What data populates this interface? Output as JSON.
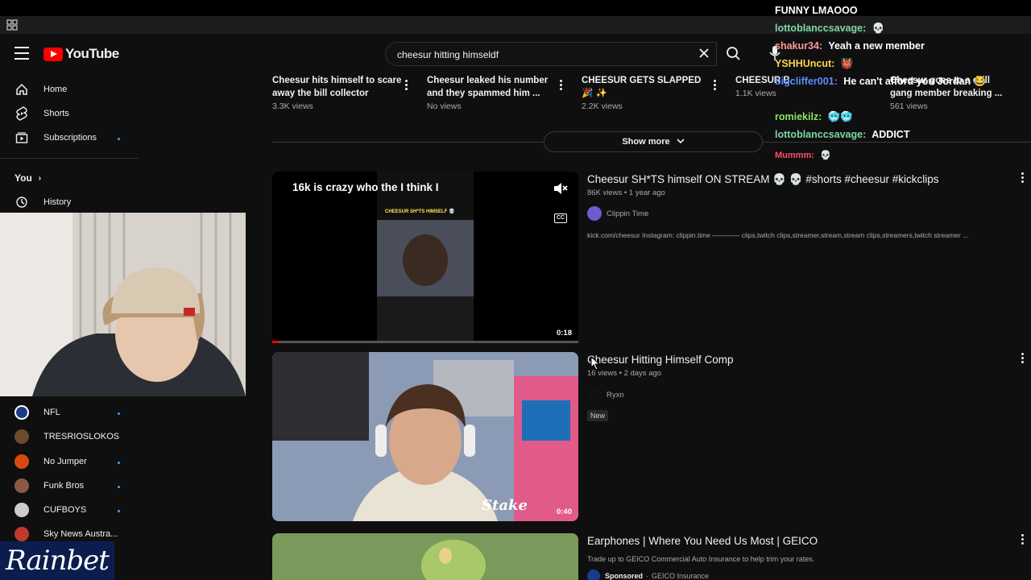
{
  "header": {
    "logo_text": "YouTube",
    "search_value": "cheesur hitting himseldf"
  },
  "sidebar": {
    "items": [
      {
        "label": "Home"
      },
      {
        "label": "Shorts"
      },
      {
        "label": "Subscriptions"
      }
    ],
    "you_label": "You",
    "history_label": "History",
    "channels": [
      {
        "label": "NFL",
        "color": "#1e3a8a"
      },
      {
        "label": "TRESRIOSLOKOS",
        "color": "#6b4b2a"
      },
      {
        "label": "No Jumper",
        "color": "#d9480f"
      },
      {
        "label": "Funk Bros",
        "color": "#8a5a44"
      },
      {
        "label": "CUFBOYS",
        "color": "#cccccc"
      },
      {
        "label": "Sky News Austra...",
        "color": "#c0392b"
      }
    ]
  },
  "rainbet": {
    "text": "Rainbet"
  },
  "shorts_row": [
    {
      "title": "Cheesur hits himself to scare away the bill collector",
      "views": "3.3K views"
    },
    {
      "title": "Cheesur leaked his number and they spammed him ...",
      "views": "No views"
    },
    {
      "title": "CHEESUR GETS SLAPPED 🎉 ✨",
      "views": "2.2K views"
    },
    {
      "title": "CHEESUR BASSED",
      "views": "1.1K views"
    },
    {
      "title": "Cheesur goes to a drill gang member breaking ...",
      "views": "561 views"
    }
  ],
  "show_more": "Show more",
  "results": [
    {
      "title": "Cheesur SH*TS himself ON STREAM 💀 💀 #shorts #cheesur #kickclips",
      "meta": "86K views • 1 year ago",
      "channel": "Clippin Time",
      "desc": "kick.com/cheesur Instagram: clippin.time ———— clips,twitch clips,streamer,stream,stream clips,streamers,twitch streamer ...",
      "overlay_text": "16k is crazy who the I think I",
      "inner_caption": "CHEESUR SH*TS HIMSELF 💀",
      "duration": "0:18",
      "cc": "CC"
    },
    {
      "title": "Cheesur Hitting Himself Comp",
      "meta": "16 views • 2 days ago",
      "channel": "Ryxn",
      "badge": "New",
      "duration": "0:40",
      "stake_text": "Stake"
    },
    {
      "title": "Earphones | Where You Need Us Most | GEICO",
      "desc": "Trade up to GEICO Commercial Auto Insurance to help trim your rates.",
      "sponsored": "Sponsored",
      "channel": "GEICO Insurance"
    }
  ],
  "chat": [
    {
      "name": "",
      "msg": "FUNNY LMAOOO",
      "color": "#ffffff"
    },
    {
      "name": "lottoblanccsavage:",
      "msg": "💀",
      "color": "#7fd6a8"
    },
    {
      "name": "shakur34:",
      "msg": "Yeah a new member",
      "color": "#ff9a9a"
    },
    {
      "name": "YSHHUncut:",
      "msg": "👹",
      "color": "#ffd24d"
    },
    {
      "name": "bigcliffer001:",
      "msg": "He can't afford you Jordan 😂",
      "color": "#5b8cff"
    },
    {
      "name": "romiekilz:",
      "msg": "🥶🥶",
      "color": "#8be36a"
    },
    {
      "name": "lottoblanccsavage:",
      "msg": "ADDICT",
      "color": "#7fd6a8"
    },
    {
      "name": "Mummm:",
      "msg": "💀",
      "color": "#ff4d6d"
    }
  ]
}
